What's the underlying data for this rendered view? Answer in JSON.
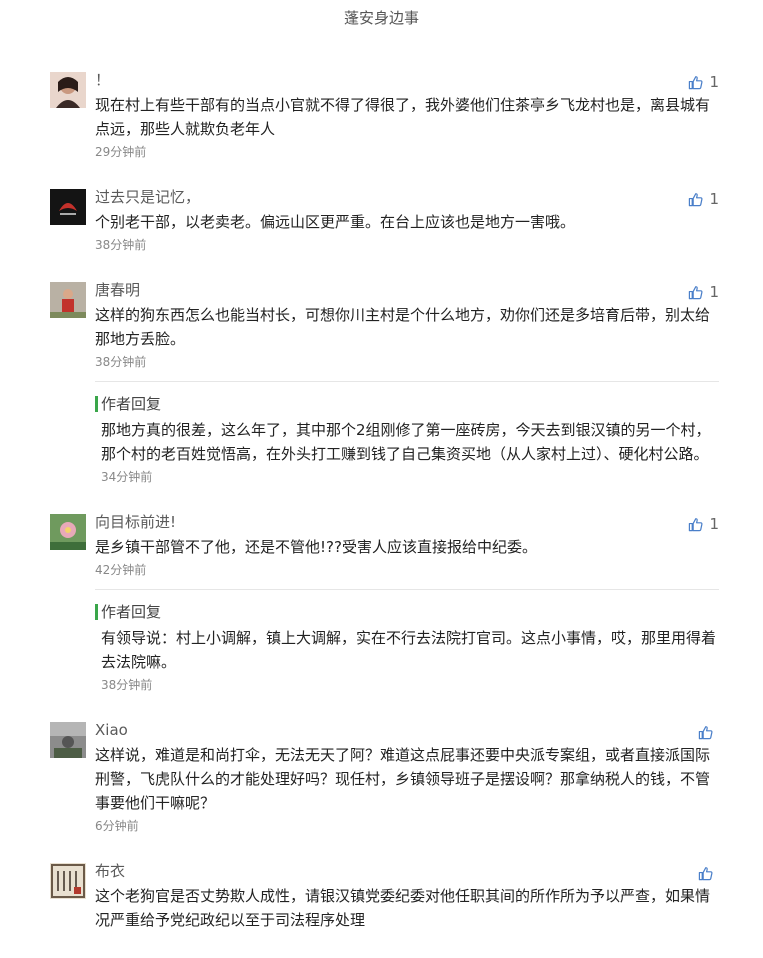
{
  "header": {
    "title": "蓬安身边事"
  },
  "comments": [
    {
      "nick": "！",
      "text": "现在村上有些干部有的当点小官就不得了得很了，我外婆他们住茶亭乡飞龙村也是，离县城有点远，那些人就欺负老年人",
      "time": "29分钟前",
      "likes": "1",
      "avatar_color": "#d8b7a6"
    },
    {
      "nick": "过去只是记忆，",
      "text": "个别老干部，以老卖老。偏远山区更严重。在台上应该也是地方一害哦。",
      "time": "38分钟前",
      "likes": "1",
      "avatar_color": "#1e1e1e"
    },
    {
      "nick": "唐春明",
      "text": "这样的狗东西怎么也能当村长，可想你川主村是个什么地方，劝你们还是多培育后带，别太给那地方丢脸。",
      "time": "38分钟前",
      "likes": "1",
      "avatar_color": "#8a7a6a",
      "reply": {
        "tag": "作者回复",
        "text": "那地方真的很差，这么年了，其中那个2组刚修了第一座砖房，今天去到银汉镇的另一个村，那个村的老百姓觉悟高，在外头打工赚到钱了自己集资买地（从人家村上过）、硬化村公路。",
        "time": "34分钟前"
      }
    },
    {
      "nick": "向目标前进!",
      "text": "是乡镇干部管不了他，还是不管他!??受害人应该直接报给中纪委。",
      "time": "42分钟前",
      "likes": "1",
      "avatar_color": "#6f9a5e",
      "reply": {
        "tag": "作者回复",
        "text": "有领导说：村上小调解，镇上大调解，实在不行去法院打官司。这点小事情，哎，那里用得着去法院嘛。",
        "time": "38分钟前"
      }
    },
    {
      "nick": "Xiao",
      "text": "这样说，难道是和尚打伞，无法无天了阿？难道这点屁事还要中央派专案组，或者直接派国际刑警，飞虎队什么的才能处理好吗？现任村，乡镇领导班子是摆设啊？那拿纳税人的钱，不管事要他们干嘛呢？",
      "time": "6分钟前",
      "likes": "",
      "avatar_color": "#7d7d7d"
    },
    {
      "nick": "布衣",
      "text": "这个老狗官是否丈势欺人成性，请银汉镇党委纪委对他任职其间的所作所为予以严查，如果情况严重给予党纪政纪以至于司法程序处理",
      "time": "",
      "likes": "",
      "avatar_color": "#b9a58c"
    }
  ],
  "colors": {
    "accent_green": "#3aa64a",
    "thumb_blue": "#4a7fc9"
  },
  "icons": {
    "like": "thumbs-up-icon"
  }
}
